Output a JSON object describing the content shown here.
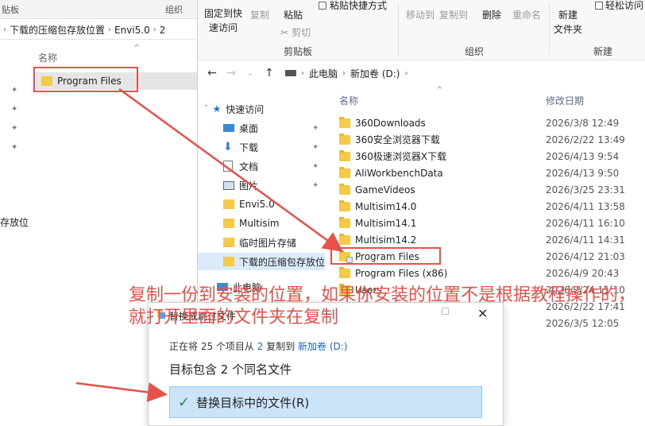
{
  "left_window": {
    "ribbon_left_label": "贴板",
    "ribbon_group_label": "组织",
    "breadcrumb": [
      "下载的压缩包存放位置",
      "Envi5.0",
      "2"
    ],
    "column_name": "名称",
    "selected_item": "Program Files",
    "cut_label": "存放位"
  },
  "right_window": {
    "ribbon": {
      "pin_quick": "固定到快\n速访问",
      "copy": "复制",
      "paste": "粘贴",
      "paste_shortcut": "粘贴快捷方式",
      "cut": "剪切",
      "clipboard_group": "剪贴板",
      "move_to": "移动到",
      "copy_to": "复制到",
      "delete": "删除",
      "rename": "重命名",
      "organize_group": "组织",
      "new_folder": "新建\n文件夹",
      "easy_access": "轻松访问",
      "new_group": "新建"
    },
    "address": [
      "此电脑",
      "新加卷 (D:)"
    ],
    "nav": {
      "quick_access": "快速访问",
      "items": [
        {
          "label": "桌面",
          "icon": "desktop-icon"
        },
        {
          "label": "下载",
          "icon": "download-icon"
        },
        {
          "label": "文档",
          "icon": "document-icon"
        },
        {
          "label": "图片",
          "icon": "picture-icon"
        },
        {
          "label": "Envi5.0",
          "icon": "folder-icon"
        },
        {
          "label": "Multisim",
          "icon": "folder-icon"
        },
        {
          "label": "临时图片存储",
          "icon": "folder-icon"
        },
        {
          "label": "下载的压缩包存放位",
          "icon": "folder-icon"
        }
      ],
      "this_pc": "此电脑"
    },
    "columns": {
      "name": "名称",
      "modified": "修改日期"
    },
    "files": [
      {
        "name": "360Downloads",
        "date": "2026/3/8 12:49"
      },
      {
        "name": "360安全浏览器下载",
        "date": "2026/2/22 13:49"
      },
      {
        "name": "360极速浏览器X下载",
        "date": "2026/4/13 9:54"
      },
      {
        "name": "AliWorkbenchData",
        "date": "2026/4/13 9:50"
      },
      {
        "name": "GameVideos",
        "date": "2026/3/25 23:31"
      },
      {
        "name": "Multisim14.0",
        "date": "2026/4/11 13:58"
      },
      {
        "name": "Multisim14.1",
        "date": "2026/4/11 16:10"
      },
      {
        "name": "Multisim14.2",
        "date": "2026/4/11 14:31"
      },
      {
        "name": "Program Files",
        "date": "2026/4/12 21:03"
      },
      {
        "name": "Program Files (x86)",
        "date": "2026/4/9 20:43"
      },
      {
        "name": "Users",
        "date": "2026/2/24 11:10"
      },
      {
        "name": "",
        "date": "2026/2/22 17:41"
      },
      {
        "name": "",
        "date": "2026/3/5 12:05"
      }
    ]
  },
  "dialog": {
    "title": "替换或跳过文件",
    "line1_prefix": "正在将 25 个项目从",
    "line1_src": "2",
    "line1_mid": "复制到",
    "line1_dst": "新加卷 (D:)",
    "line2": "目标包含 2 个同名文件",
    "option_replace": "替换目标中的文件(R)"
  },
  "annotation": "复制一份到安装的位置，如果你安装的位置不是根据教程操作的，就打开里面的文件夹在复制",
  "colors": {
    "annotation_red": "#e8504a",
    "selection_blue": "#cce4f7",
    "link_blue": "#1a66c7"
  }
}
